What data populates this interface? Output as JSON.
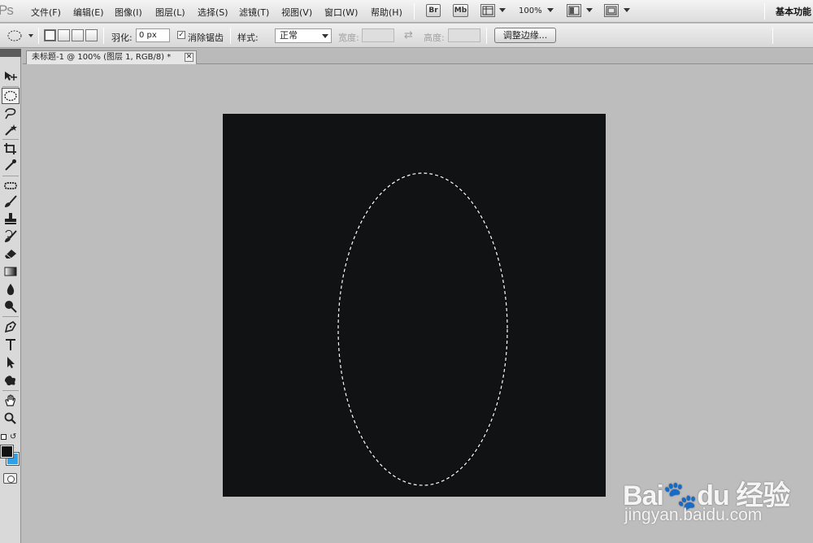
{
  "app": {
    "logo": "Ps"
  },
  "menu": {
    "items": [
      "文件(F)",
      "编辑(E)",
      "图像(I)",
      "图层(L)",
      "选择(S)",
      "滤镜(T)",
      "视图(V)",
      "窗口(W)",
      "帮助(H)"
    ],
    "bridge_label": "Br",
    "minibridge_label": "Mb",
    "zoom": "100%",
    "workspace": "基本功能"
  },
  "options": {
    "feather_label": "羽化:",
    "feather_value": "0 px",
    "antialias_label": "消除锯齿",
    "antialias_checked": "✓",
    "style_label": "样式:",
    "style_value": "正常",
    "width_label": "宽度:",
    "swap_icon": "⇄",
    "height_label": "高度:",
    "refine_edge": "调整边缘..."
  },
  "document": {
    "tab_title": "未标题-1 @ 100% (图层 1, RGB/8) *",
    "close_glyph": "✕",
    "canvas_color": "#111214"
  },
  "colors": {
    "foreground": "#111111",
    "background": "#2fa0e8"
  },
  "watermark": {
    "brand": "Bai🐾du 经验",
    "url": "jingyan.baidu.com"
  }
}
